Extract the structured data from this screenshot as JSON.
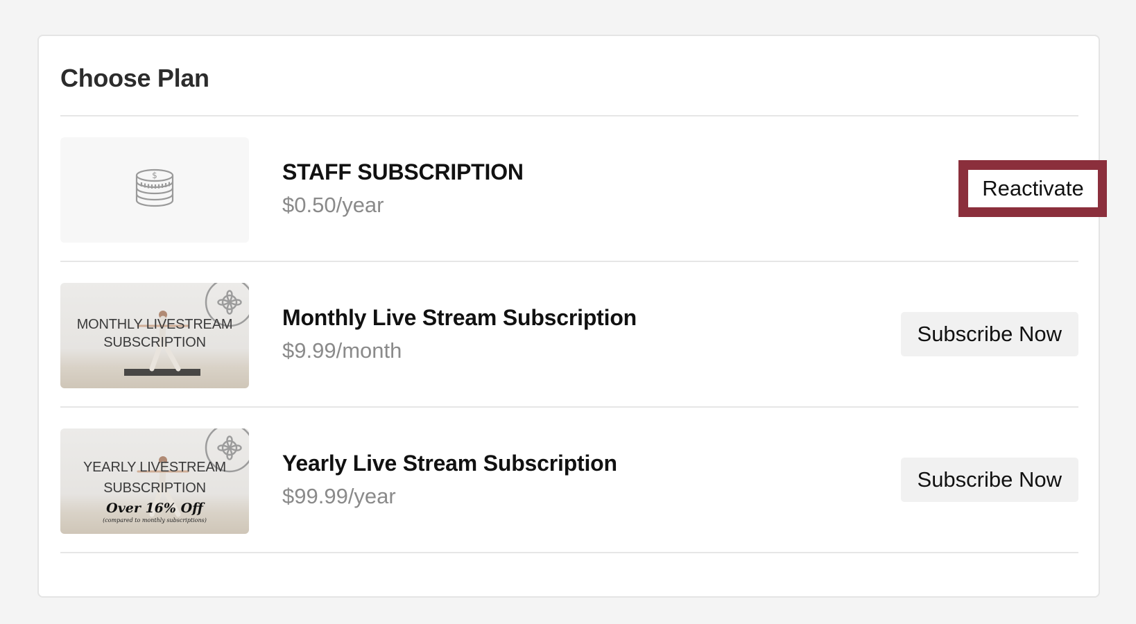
{
  "page": {
    "title": "Choose Plan"
  },
  "plans": [
    {
      "name": "STAFF SUBSCRIPTION",
      "price": "$0.50/year",
      "action": "Reactivate",
      "thumbnail_icon": "coin-stack-icon"
    },
    {
      "name": "Monthly Live Stream Subscription",
      "price": "$9.99/month",
      "action": "Subscribe Now",
      "thumbnail_text": [
        "MONTHLY LIVESTREAM",
        "SUBSCRIPTION"
      ]
    },
    {
      "name": "Yearly Live Stream Subscription",
      "price": "$99.99/year",
      "action": "Subscribe Now",
      "thumbnail_text": [
        "YEARLY LIVESTREAM",
        "SUBSCRIPTION"
      ],
      "thumbnail_promo": "Over 16% Off",
      "thumbnail_note": "(compared to monthly subscriptions)"
    }
  ],
  "colors": {
    "highlight": "#8b2f3c",
    "price": "#8a8a8a",
    "button_bg": "#f1f1f1"
  }
}
